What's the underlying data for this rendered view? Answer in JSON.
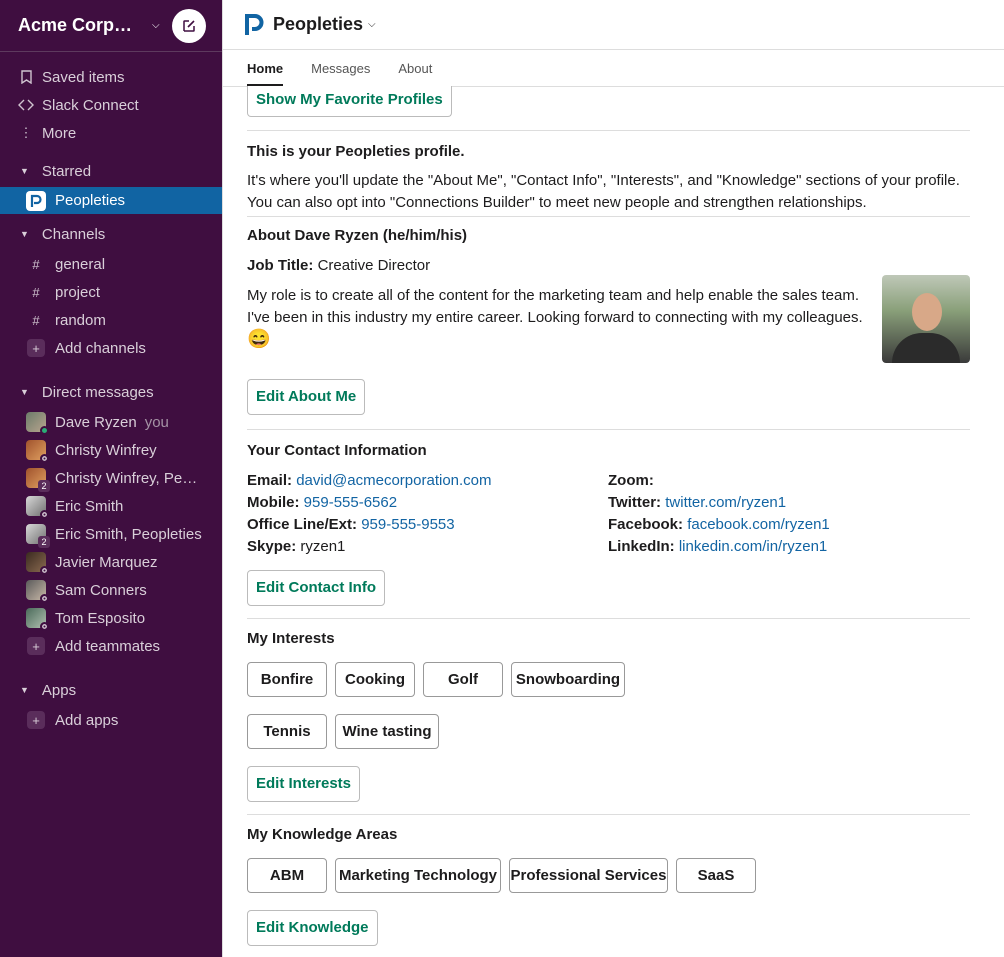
{
  "workspace": {
    "name": "Acme Corporation"
  },
  "sidebar": {
    "top_items": [
      {
        "label": "Saved items",
        "icon": "bookmark-icon"
      },
      {
        "label": "Slack Connect",
        "icon": "slack-connect-icon"
      },
      {
        "label": "More",
        "icon": "more-vertical-icon"
      }
    ],
    "starred": {
      "title": "Starred",
      "items": [
        {
          "label": "Peopleties"
        }
      ]
    },
    "channels": {
      "title": "Channels",
      "items": [
        {
          "label": "general"
        },
        {
          "label": "project"
        },
        {
          "label": "random"
        }
      ],
      "add_label": "Add channels"
    },
    "dms": {
      "title": "Direct messages",
      "items": [
        {
          "label": "Dave Ryzen",
          "suffix": "you"
        },
        {
          "label": "Christy Winfrey"
        },
        {
          "label": "Christy Winfrey, Peopleties",
          "count": "2"
        },
        {
          "label": "Eric Smith"
        },
        {
          "label": "Eric Smith, Peopleties",
          "count": "2"
        },
        {
          "label": "Javier Marquez"
        },
        {
          "label": "Sam Conners"
        },
        {
          "label": "Tom Esposito"
        }
      ],
      "add_label": "Add teammates"
    },
    "apps": {
      "title": "Apps",
      "add_label": "Add apps"
    }
  },
  "app": {
    "title": "Peopleties",
    "tabs": [
      {
        "label": "Home"
      },
      {
        "label": "Messages"
      },
      {
        "label": "About"
      }
    ]
  },
  "home": {
    "favorites_button": "Show My Favorite Profiles",
    "intro_title": "This is your Peopleties profile.",
    "intro_text": "It's where you'll update the \"About Me\", \"Contact Info\", \"Interests\", and \"Knowledge\" sections of your profile. You can also opt into \"Connections Builder\" to meet new people and strengthen relationships.",
    "about_title": "About Dave Ryzen (he/him/his)",
    "job_title_label": "Job Title:",
    "job_title_value": "Creative Director",
    "bio": "My role is to create all of the content for the marketing team and help enable the sales team. I've been in this industry my entire career. Looking forward to connecting with my colleagues.",
    "bio_emoji": "😄",
    "edit_about": "Edit About Me",
    "contact_title": "Your Contact Information",
    "contact_left": [
      {
        "label": "Email:",
        "value": "david@acmecorporation.com",
        "link": true
      },
      {
        "label": "Mobile:",
        "value": "959-555-6562",
        "link": true
      },
      {
        "label": "Office Line/Ext:",
        "value": "959-555-9553",
        "link": true
      },
      {
        "label": "Skype:",
        "value": "ryzen1",
        "link": false
      }
    ],
    "contact_right": [
      {
        "label": "Zoom:",
        "value": "",
        "link": false
      },
      {
        "label": "Twitter:",
        "value": "twitter.com/ryzen1",
        "link": true
      },
      {
        "label": "Facebook:",
        "value": "facebook.com/ryzen1",
        "link": true
      },
      {
        "label": "LinkedIn:",
        "value": "linkedin.com/in/ryzen1",
        "link": true
      }
    ],
    "edit_contact": "Edit Contact Info",
    "interests_title": "My Interests",
    "interests": [
      "Bonfire",
      "Cooking",
      "Golf",
      "Snowboarding",
      "Tennis",
      "Wine tasting"
    ],
    "edit_interests": "Edit Interests",
    "knowledge_title": "My Knowledge Areas",
    "knowledge": [
      "ABM",
      "Marketing Technology",
      "Professional Services",
      "SaaS"
    ],
    "edit_knowledge": "Edit Knowledge"
  },
  "colors": {
    "sidebar_bg": "#3f0e40",
    "active_item": "#1164a3",
    "link": "#1264a3",
    "button_green": "#007a5a"
  }
}
